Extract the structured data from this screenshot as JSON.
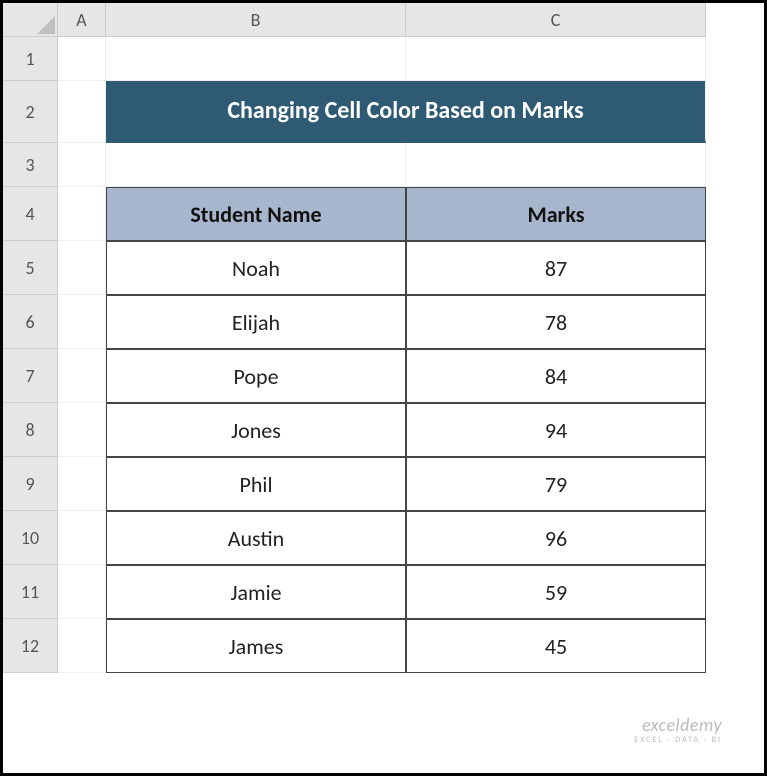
{
  "columns": [
    "A",
    "B",
    "C"
  ],
  "rows": [
    "1",
    "2",
    "3",
    "4",
    "5",
    "6",
    "7",
    "8",
    "9",
    "10",
    "11",
    "12"
  ],
  "title": "Changing Cell Color Based on Marks",
  "headers": {
    "name": "Student Name",
    "marks": "Marks"
  },
  "students": [
    {
      "name": "Noah",
      "marks": 87
    },
    {
      "name": "Elijah",
      "marks": 78
    },
    {
      "name": "Pope",
      "marks": 84
    },
    {
      "name": "Jones",
      "marks": 94
    },
    {
      "name": "Phil",
      "marks": 79
    },
    {
      "name": "Austin",
      "marks": 96
    },
    {
      "name": "Jamie",
      "marks": 59
    },
    {
      "name": "James",
      "marks": 45
    }
  ],
  "watermark": {
    "line1": "exceldemy",
    "line2": "EXCEL · DATA · BI"
  },
  "chart_data": {
    "type": "table",
    "title": "Changing Cell Color Based on Marks",
    "columns": [
      "Student Name",
      "Marks"
    ],
    "rows": [
      [
        "Noah",
        87
      ],
      [
        "Elijah",
        78
      ],
      [
        "Pope",
        84
      ],
      [
        "Jones",
        94
      ],
      [
        "Phil",
        79
      ],
      [
        "Austin",
        96
      ],
      [
        "Jamie",
        59
      ],
      [
        "James",
        45
      ]
    ]
  }
}
